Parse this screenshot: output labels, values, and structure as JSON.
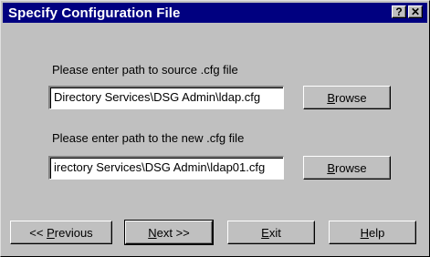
{
  "dialog": {
    "title": "Specify Configuration File",
    "help_glyph": "?",
    "close_glyph": "✕"
  },
  "source": {
    "prompt": "Please enter path to source .cfg file",
    "value": "Directory Services\\DSG Admin\\ldap.cfg",
    "browse_label": "Browse"
  },
  "target": {
    "prompt": "Please enter path to the new .cfg file",
    "value": "irectory Services\\DSG Admin\\ldap01.cfg",
    "browse_label": "Browse"
  },
  "footer": {
    "previous_label": "<< Previous",
    "next_label": "Next >>",
    "exit_label": "Exit",
    "help_label": "Help"
  },
  "icons": {
    "help": "help-icon",
    "close": "close-icon"
  }
}
